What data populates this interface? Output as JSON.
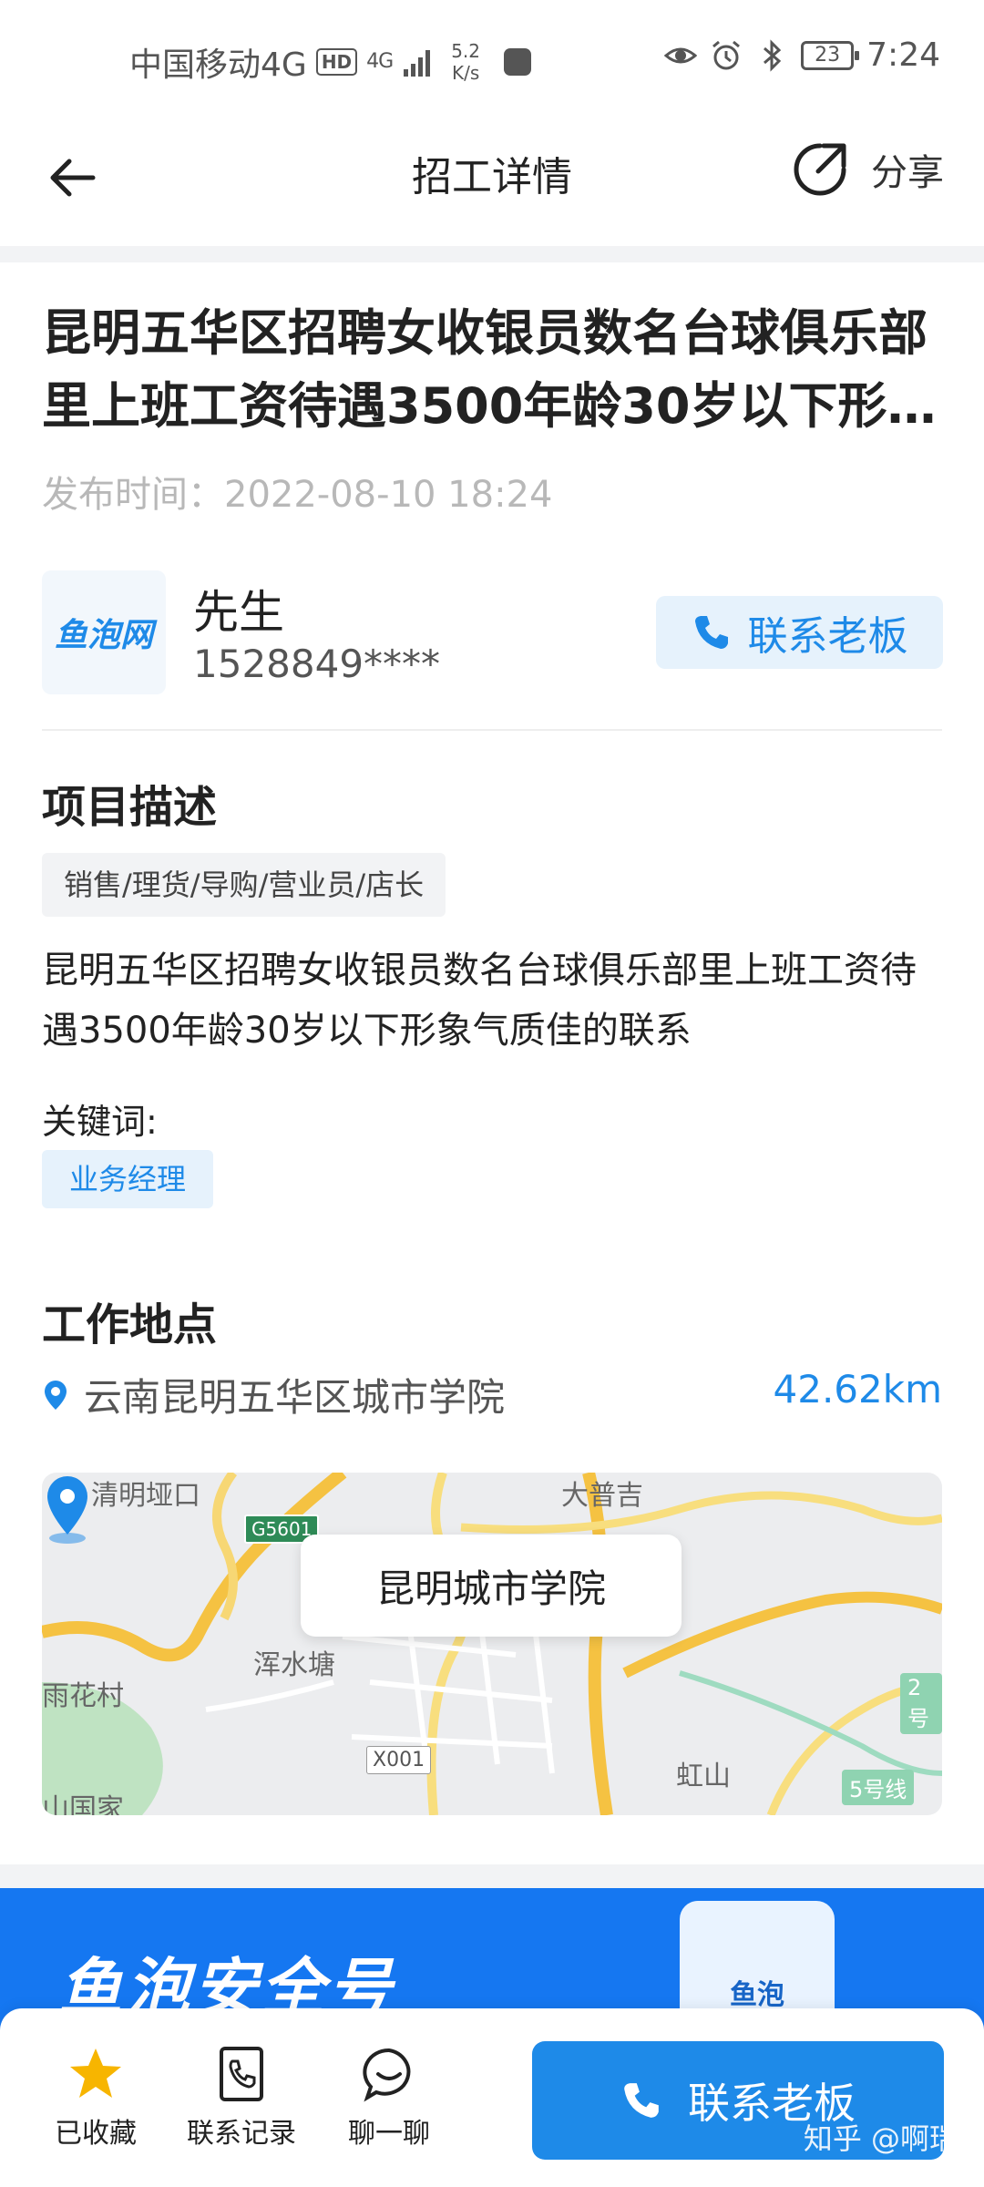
{
  "status_bar": {
    "carrier": "中国移动4G",
    "hd_badge": "HD",
    "network": "4G",
    "speed_value": "5.2",
    "speed_unit": "K/s",
    "battery": "23",
    "time": "7:24"
  },
  "header": {
    "title": "招工详情",
    "share_label": "分享"
  },
  "job": {
    "title": "昆明五华区招聘女收银员数名台球俱乐部里上班工资待遇3500年龄30岁以下形象气质佳的联系",
    "publish_label": "发布时间：",
    "publish_time": "2022-08-10 18:24"
  },
  "boss": {
    "logo_text": "鱼泡网",
    "name": "先生",
    "phone": "1528849****",
    "contact_label": "联系老板"
  },
  "description": {
    "section_title": "项目描述",
    "category_tag": "销售/理货/导购/营业员/店长",
    "text": "昆明五华区招聘女收银员数名台球俱乐部里上班工资待遇3500年龄30岁以下形象气质佳的联系",
    "keywords_label": "关键词:",
    "keyword": "业务经理"
  },
  "location": {
    "section_title": "工作地点",
    "address": "云南昆明五华区城市学院",
    "distance": "42.62km"
  },
  "map": {
    "callout": "昆明城市学院",
    "labels": {
      "qingming": "清明垭口",
      "dapuji": "大普吉",
      "g5601": "G5601",
      "hunshuitang": "浑水塘",
      "yuhuacun": "雨花村",
      "x001": "X001",
      "hongshan": "虹山",
      "line5": "5号线",
      "line2": "2号",
      "shanguojia": "山国家"
    }
  },
  "banner": {
    "text": "鱼泡安全号",
    "badge": "鱼泡"
  },
  "bottom_bar": {
    "favorite_label": "已收藏",
    "records_label": "联系记录",
    "chat_label": "聊一聊",
    "cta_label": "联系老板"
  },
  "watermark": "知乎 @啊瑞",
  "colors": {
    "accent": "#1e8ae8",
    "star": "#f7b500",
    "banner": "#1577f1"
  }
}
